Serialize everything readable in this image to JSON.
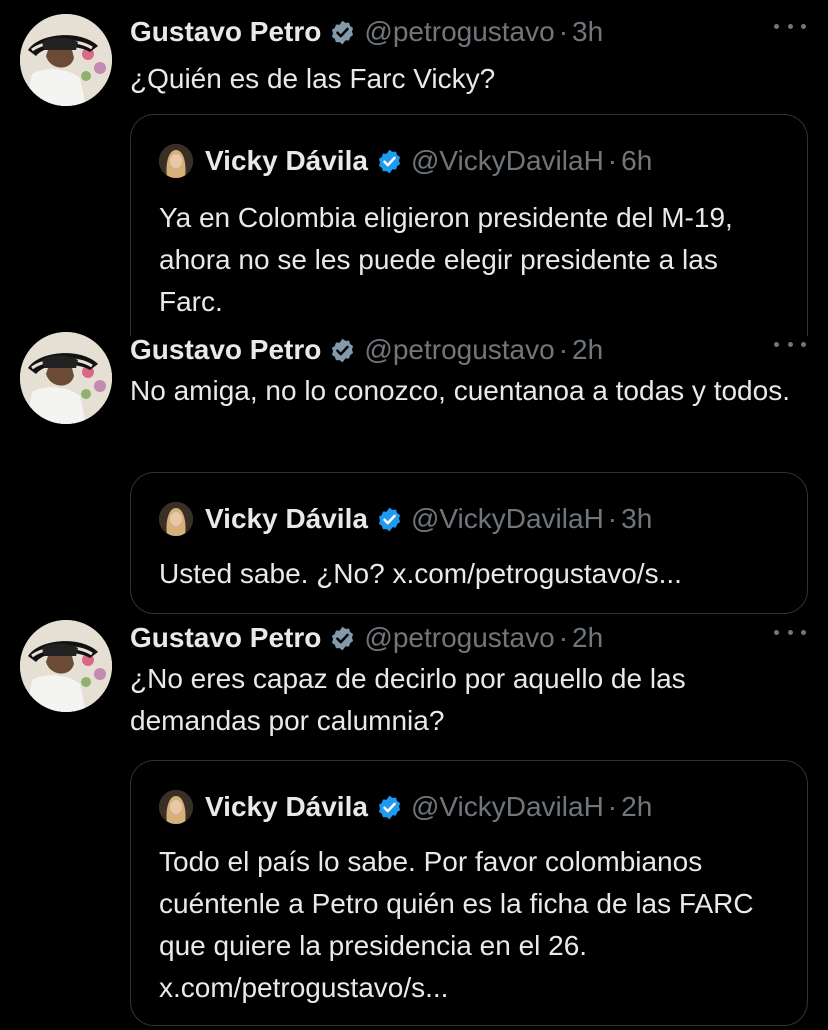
{
  "colors": {
    "background": "#000000",
    "text_primary": "#e7e9ea",
    "text_secondary": "#71767b",
    "border": "#2f3336",
    "verified_blue": "#1d9bf0",
    "verified_gray": "#829aab"
  },
  "thread": [
    {
      "author": {
        "name": "Gustavo Petro",
        "handle": "@petrogustavo",
        "badge": "gray-verified-badge-icon"
      },
      "time": "3h",
      "text": "¿Quién es de las Farc Vicky?",
      "quote": {
        "author": {
          "name": "Vicky Dávila",
          "handle": "@VickyDavilaH",
          "badge": "blue-verified-badge-icon"
        },
        "time": "6h",
        "text": "Ya en Colombia eligieron presidente del M-19, ahora no se les puede elegir presidente a las Farc."
      }
    },
    {
      "author": {
        "name": "Gustavo Petro",
        "handle": "@petrogustavo",
        "badge": "gray-verified-badge-icon"
      },
      "time": "2h",
      "text": "No amiga, no lo conozco, cuentanoa a todas y todos.",
      "quote": {
        "author": {
          "name": "Vicky Dávila",
          "handle": "@VickyDavilaH",
          "badge": "blue-verified-badge-icon"
        },
        "time": "3h",
        "text": "Usted sabe. ¿No? x.com/petrogustavo/s..."
      }
    },
    {
      "author": {
        "name": "Gustavo Petro",
        "handle": "@petrogustavo",
        "badge": "gray-verified-badge-icon"
      },
      "time": "2h",
      "text": "¿No eres capaz de decirlo por aquello de las demandas por calumnia?",
      "quote": {
        "author": {
          "name": "Vicky Dávila",
          "handle": "@VickyDavilaH",
          "badge": "blue-verified-badge-icon"
        },
        "time": "2h",
        "text": "Todo el país lo sabe. Por favor colombianos cuéntenle a Petro quién es la ficha de las FARC que quiere la presidencia en el 26. x.com/petrogustavo/s..."
      }
    }
  ]
}
